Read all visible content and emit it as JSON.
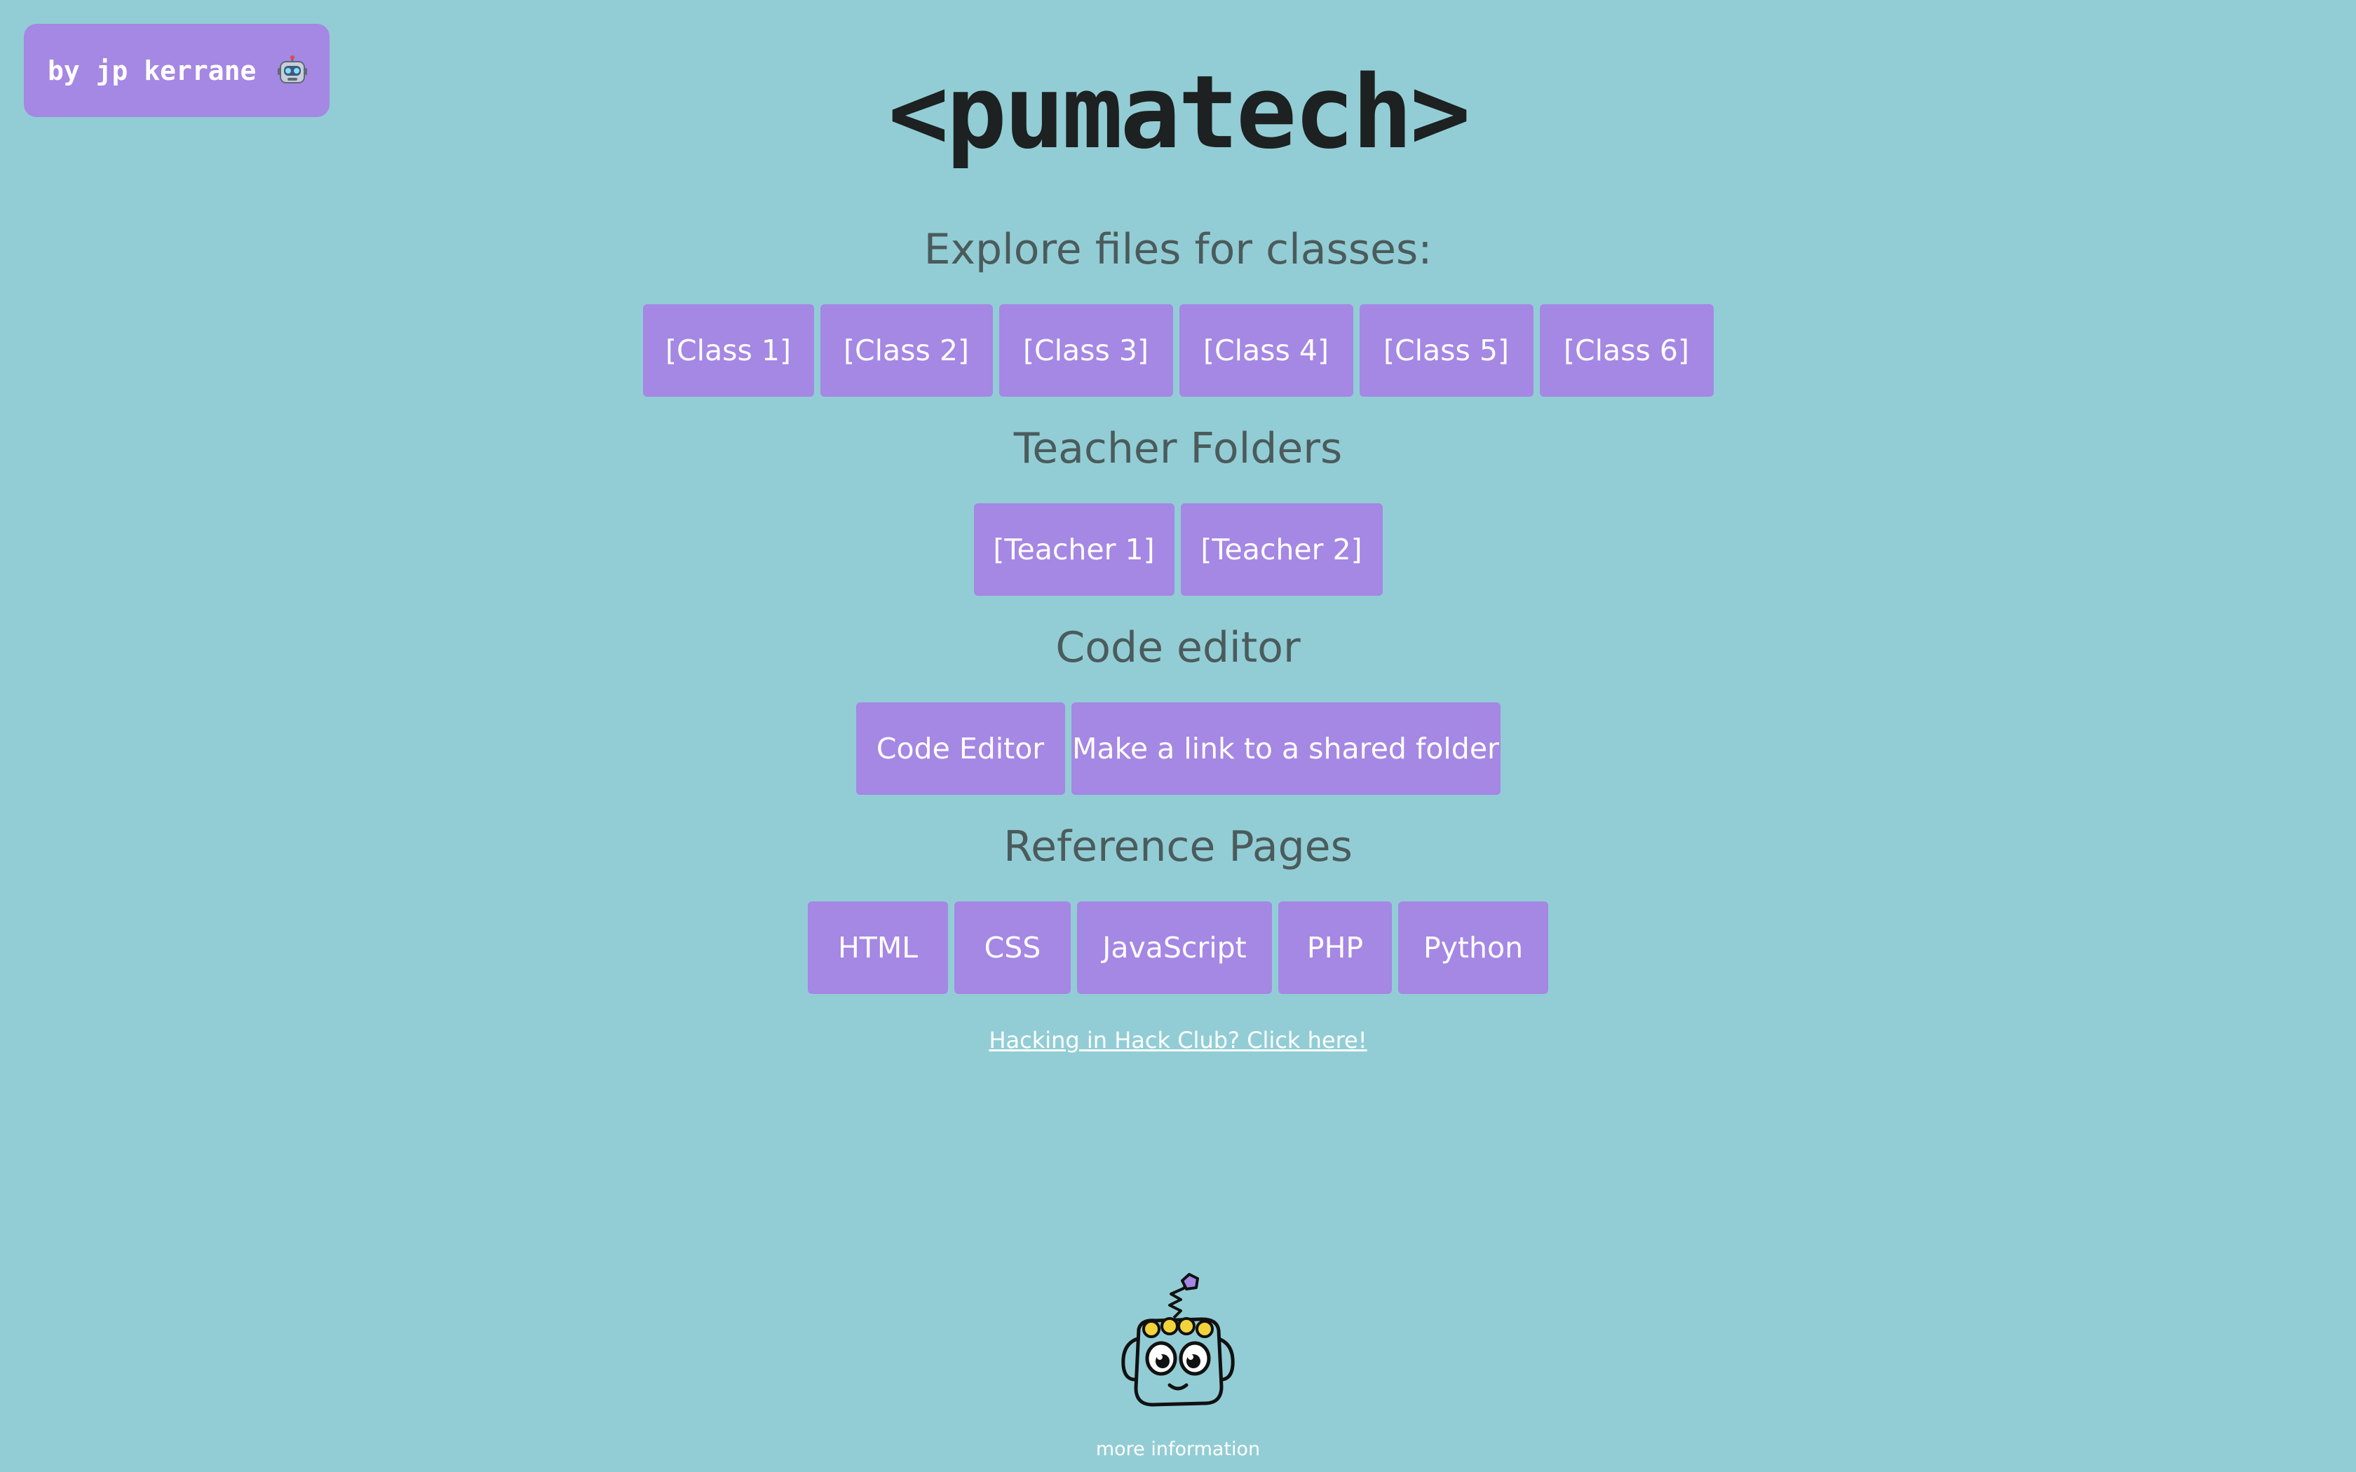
{
  "author_badge": {
    "label": "by jp kerrane",
    "icon": "robot-emoji-icon"
  },
  "title": "<pumatech>",
  "sections": {
    "classes": {
      "heading": "Explore files for classes:",
      "buttons": [
        "[Class 1]",
        "[Class 2]",
        "[Class 3]",
        "[Class 4]",
        "[Class 5]",
        "[Class 6]"
      ]
    },
    "teachers": {
      "heading": "Teacher Folders",
      "buttons": [
        "[Teacher 1]",
        "[Teacher 2]"
      ]
    },
    "code_editor": {
      "heading": "Code editor",
      "buttons": [
        "Code Editor",
        "Make a link to a shared folder"
      ]
    },
    "reference": {
      "heading": "Reference Pages",
      "buttons": [
        "HTML",
        "CSS",
        "JavaScript",
        "PHP",
        "Python"
      ]
    }
  },
  "hack_club_link": "Hacking in Hack Club? Click here!",
  "mascot_icon": "robot-mascot-icon",
  "more_info": "more information",
  "colors": {
    "background": "#92cdd5",
    "button": "#a587e4",
    "heading_text": "#4b5b5c",
    "title_text": "#1d2121",
    "button_text": "#ffffff"
  }
}
